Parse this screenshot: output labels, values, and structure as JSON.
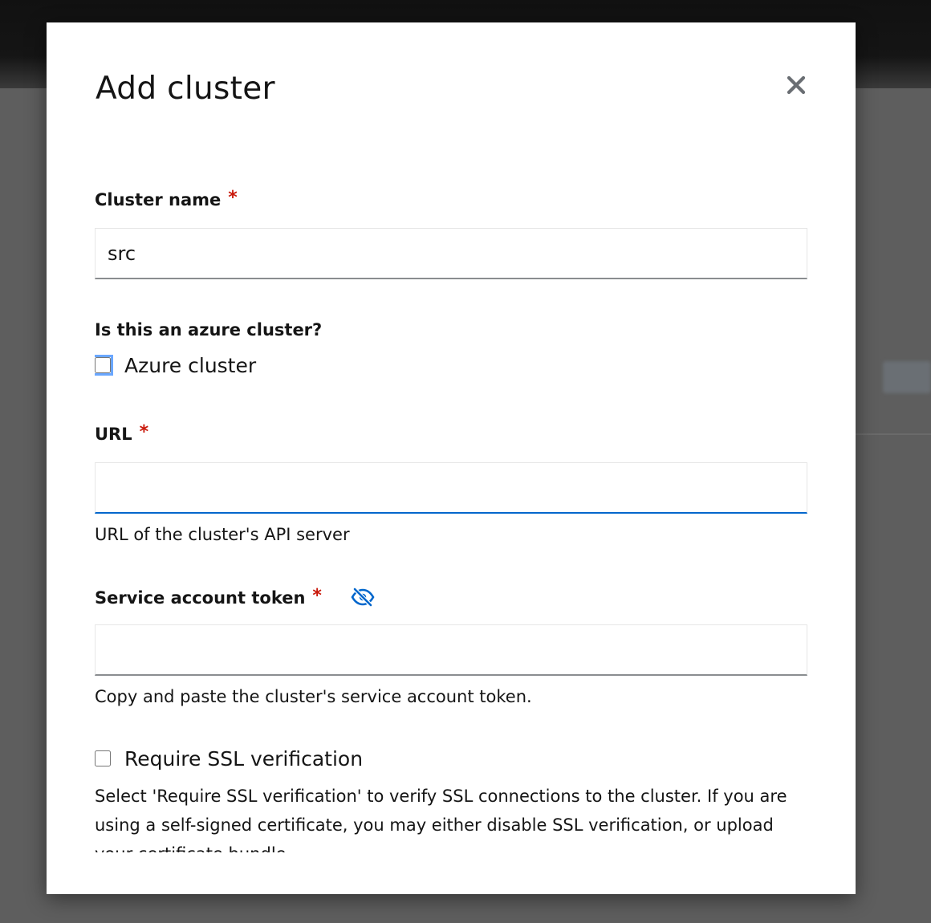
{
  "modal": {
    "title": "Add cluster",
    "close_label": "×"
  },
  "fields": {
    "cluster_name": {
      "label": "Cluster name",
      "required_mark": "*",
      "value": "src"
    },
    "azure": {
      "question": "Is this an azure cluster?",
      "checkbox_label": "Azure cluster",
      "checked": false
    },
    "url": {
      "label": "URL",
      "required_mark": "*",
      "value": "",
      "helper": "URL of the cluster's API server"
    },
    "token": {
      "label": "Service account token",
      "required_mark": "*",
      "visibility_icon": "eye-slash-icon",
      "value": "",
      "helper": "Copy and paste the cluster's service account token."
    },
    "ssl": {
      "checkbox_label": "Require SSL verification",
      "checked": false,
      "description": "Select 'Require SSL verification' to verify SSL connections to the cluster. If you are using a self-signed certificate, you may either disable SSL verification, or upload your certificate bundle."
    }
  },
  "colors": {
    "required": "#c9190b",
    "focus": "#0066cc",
    "icon_blue": "#0066cc"
  }
}
